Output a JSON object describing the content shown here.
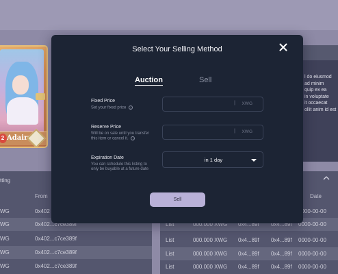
{
  "background": {
    "card": {
      "name": "Adaira",
      "level": "2"
    },
    "description": [
      "l do eiusmod",
      "ad minim",
      "quip ex ea",
      "in voluptate",
      "it occaecat",
      "ollit anim id est"
    ],
    "listing": {
      "title": "tting",
      "from_header": "From",
      "rows": [
        {
          "price": "WG",
          "from": "0x402"
        },
        {
          "price": "WG",
          "from": "0x402...c7ce389f"
        },
        {
          "price": "WG",
          "from": "0x402...c7ce389f"
        },
        {
          "price": "WG",
          "from": "0x402...c7ce389f"
        },
        {
          "price": "WG",
          "from": "0x402...c7ce389f"
        }
      ]
    },
    "offers": {
      "date_header": "Date",
      "rows": [
        {
          "type": "",
          "price": "",
          "from": "",
          "to": "",
          "date": "0000-00-00"
        },
        {
          "type": "List",
          "price": "000.000 XWG",
          "from": "0x4...89f",
          "to": "0x4...89f",
          "date": "0000-00-00"
        },
        {
          "type": "List",
          "price": "000.000 XWG",
          "from": "0x4...89f",
          "to": "0x4...89f",
          "date": "0000-00-00"
        },
        {
          "type": "List",
          "price": "000.000 XWG",
          "from": "0x4...89f",
          "to": "0x4...89f",
          "date": "0000-00-00"
        },
        {
          "type": "List",
          "price": "000.000 XWG",
          "from": "0x4...89f",
          "to": "0x4...89f",
          "date": "0000-00-00"
        }
      ]
    }
  },
  "modal": {
    "title": "Select Your Selling Method",
    "close_icon": "close-icon",
    "tabs": [
      {
        "label": "Auction",
        "active": true
      },
      {
        "label": "Sell",
        "active": false
      }
    ],
    "fixed_price": {
      "label": "Fixed Price",
      "hint": "Set your fixed price",
      "value": "",
      "unit_separator": "|",
      "unit": "XWG"
    },
    "reserve_price": {
      "label": "Reserve Price",
      "hint_line1": "Will be on sale until you transfer",
      "hint_line2": "this item or cancel it.",
      "value": "",
      "unit_separator": "|",
      "unit": "XWG"
    },
    "expiration": {
      "label": "Expiration Date",
      "hint_line1": "You can schedule this listing to",
      "hint_line2": "only be buyable at a future date",
      "selected": "in 1 day"
    },
    "info_icon_glyph": "i",
    "sell_button": "Sell"
  },
  "colors": {
    "overlay": "#8e8aa6",
    "modal_bg": "#1c2434",
    "input_border": "#3a4358",
    "button_bg": "#b9b1d8",
    "hint_text": "#8b91a3"
  }
}
